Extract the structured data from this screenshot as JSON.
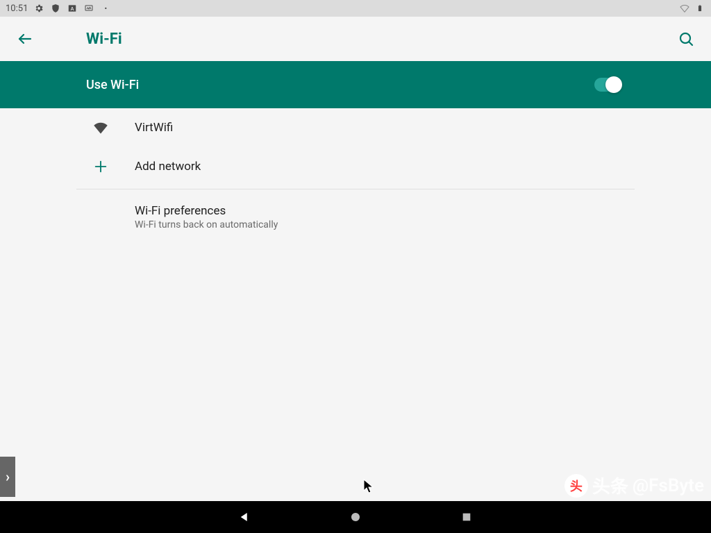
{
  "statusbar": {
    "time": "10:51",
    "icons_left": [
      "gear",
      "shield",
      "square-a",
      "image",
      "dot"
    ],
    "icons_right": [
      "wifi-outline",
      "battery"
    ]
  },
  "header": {
    "title": "Wi-Fi"
  },
  "banner": {
    "label": "Use Wi-Fi",
    "toggle_on": true
  },
  "networks": [
    {
      "ssid": "VirtWifi",
      "icon": "wifi"
    }
  ],
  "actions": {
    "add_network_label": "Add network"
  },
  "preferences": {
    "title": "Wi-Fi preferences",
    "subtitle": "Wi-Fi turns back on automatically"
  },
  "side_handle": "›",
  "watermark": {
    "logo_text": "头",
    "prefix": "头条",
    "handle": "@FsByte"
  },
  "colors": {
    "accent": "#00796b"
  }
}
